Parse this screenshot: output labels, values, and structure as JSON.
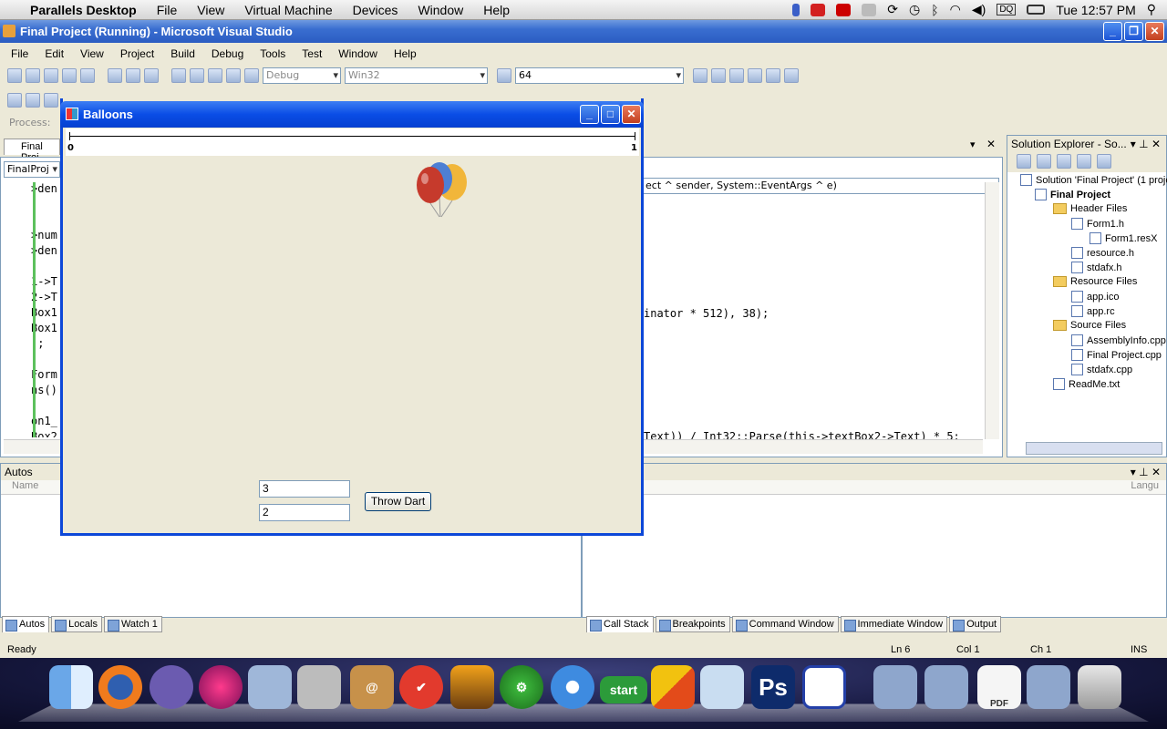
{
  "mac_menubar": {
    "app_name": "Parallels Desktop",
    "menus": [
      "File",
      "View",
      "Virtual Machine",
      "Devices",
      "Window",
      "Help"
    ],
    "clock": "Tue 12:57 PM",
    "status_icons": [
      "battery-icon",
      "acrobat-icon",
      "parallels-icon",
      "grid-icon",
      "sync-icon",
      "timemachine-icon",
      "bluetooth-icon",
      "wifi-icon",
      "volume-icon",
      "dq-icon",
      "battery-meter-icon",
      "spotlight-icon"
    ],
    "dq_label": "DQ"
  },
  "vs": {
    "title": "Final Project (Running) - Microsoft Visual Studio",
    "menus": [
      "File",
      "Edit",
      "View",
      "Project",
      "Build",
      "Debug",
      "Tools",
      "Test",
      "Window",
      "Help"
    ],
    "config_combo": "Debug",
    "platform_combo": "Win32",
    "find_combo": "64",
    "process_label": "Process:",
    "doc_tab": "Final Proj",
    "class_combo": "FinalProj",
    "method_combo": "ect ^ sender, System::EventArgs ^ e)",
    "code_left": [
      ">den",
      ";",
      "",
      ">num",
      ">den",
      "",
      "1->T",
      "2->T",
      "Box1",
      "Box1",
      ");",
      "",
      "Form",
      "ns()",
      "",
      "on1_",
      "Box2"
    ],
    "code_right_1": "inator * 512), 38);",
    "code_right_2": "Text)) / Int32::Parse(this->textBox2->Text) * 5:",
    "solution_explorer": {
      "title": "Solution Explorer - So...",
      "items": [
        {
          "label": "Solution 'Final Project' (1 proje",
          "bold": false
        },
        {
          "label": "Final Project",
          "bold": true
        },
        {
          "label": "Header Files",
          "bold": false
        },
        {
          "label": "Form1.h",
          "bold": false
        },
        {
          "label": "Form1.resX",
          "bold": false
        },
        {
          "label": "resource.h",
          "bold": false
        },
        {
          "label": "stdafx.h",
          "bold": false
        },
        {
          "label": "Resource Files",
          "bold": false
        },
        {
          "label": "app.ico",
          "bold": false
        },
        {
          "label": "app.rc",
          "bold": false
        },
        {
          "label": "Source Files",
          "bold": false
        },
        {
          "label": "AssemblyInfo.cpp",
          "bold": false
        },
        {
          "label": "Final Project.cpp",
          "bold": false
        },
        {
          "label": "stdafx.cpp",
          "bold": false
        },
        {
          "label": "ReadMe.txt",
          "bold": false
        }
      ]
    },
    "autos": {
      "title": "Autos",
      "col_name": "Name",
      "col_lang": "Langu"
    },
    "bottom_tabs_left": [
      "Autos",
      "Locals",
      "Watch 1"
    ],
    "bottom_tabs_right": [
      "Call Stack",
      "Breakpoints",
      "Command Window",
      "Immediate Window",
      "Output"
    ],
    "status": {
      "left": "Ready",
      "ln": "Ln 6",
      "col": "Col 1",
      "ch": "Ch 1",
      "ins": "INS"
    }
  },
  "form": {
    "title": "Balloons",
    "scale_min": "0",
    "scale_max": "1",
    "textbox1": "3",
    "textbox2": "2",
    "throw_button": "Throw Dart"
  },
  "dock": {
    "items": [
      "finder",
      "firefox",
      "quill",
      "burst",
      "iphoto",
      "boot",
      "address-book",
      "check",
      "iphoto-cam",
      "gear",
      "itunes",
      "start",
      "crossover",
      "parallels-vm",
      "ps",
      "win-app",
      "applications",
      "documents",
      "pdf",
      "folder",
      "trash"
    ],
    "ps_label": "Ps",
    "start_label": "start",
    "pdf_label": "PDF"
  },
  "colors": {
    "title_blue": "#0a4de6",
    "vs_title": "#3a6ed0"
  }
}
